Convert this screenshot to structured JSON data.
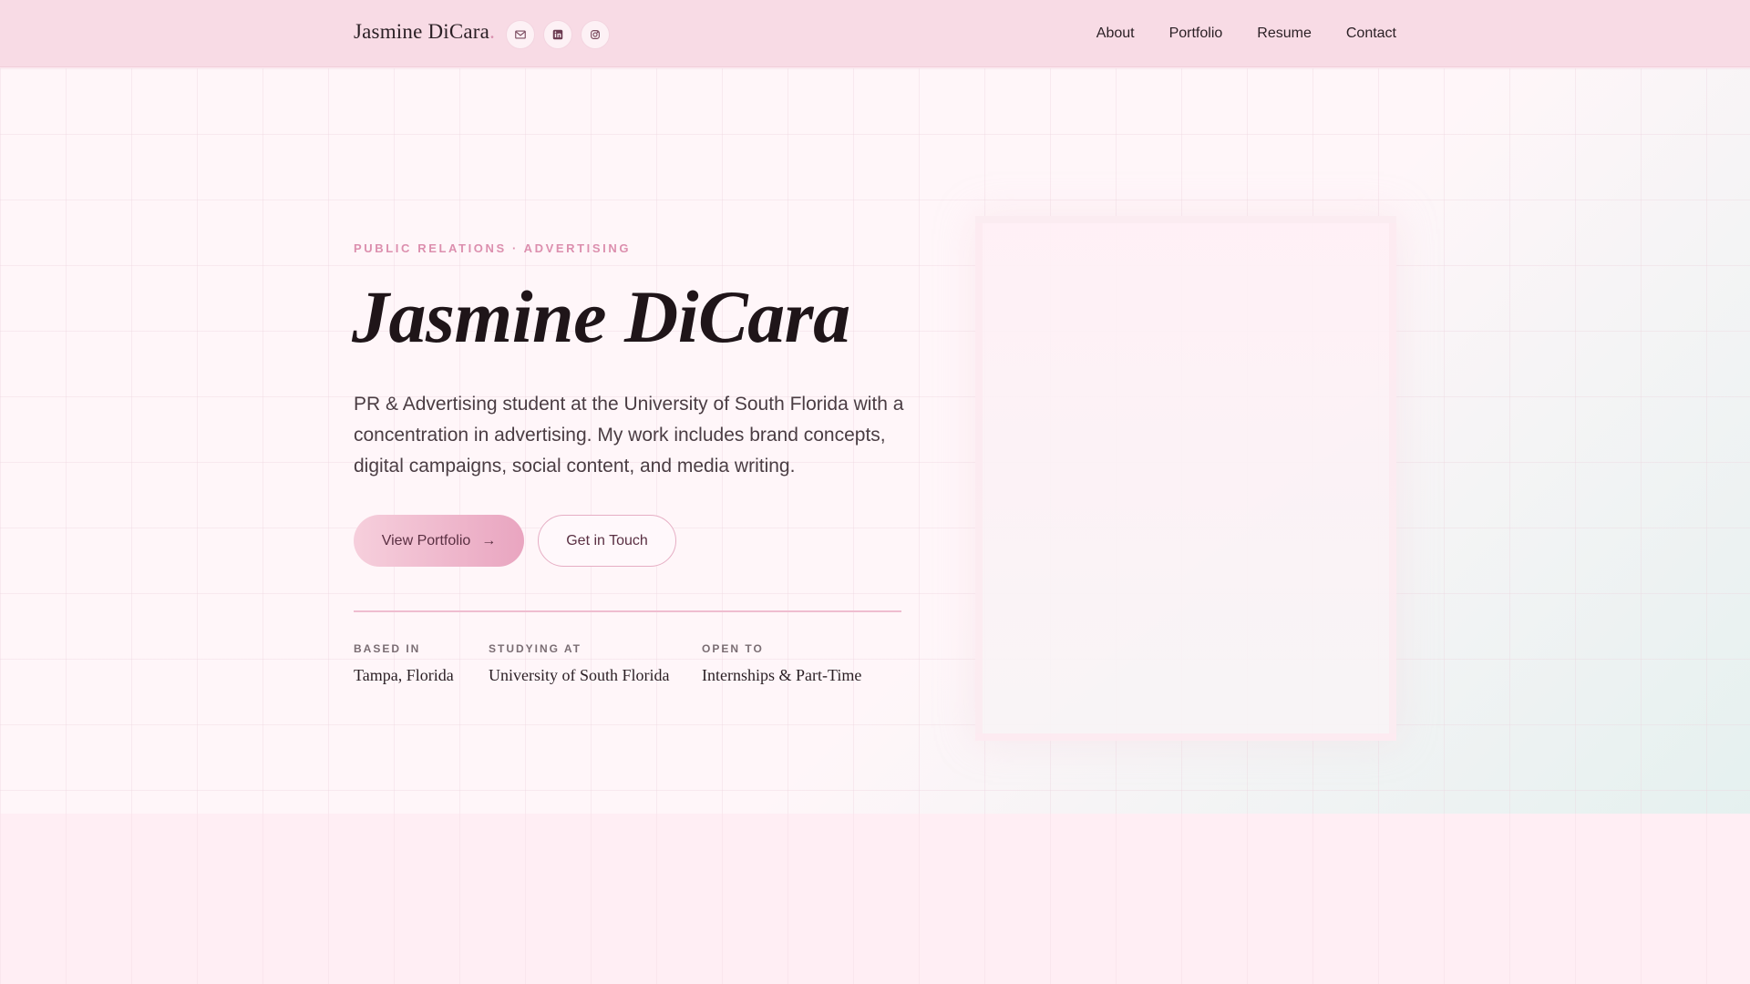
{
  "nav": {
    "brand": "Jasmine DiCara",
    "brand_dot": ".",
    "social": [
      {
        "icon": "mail-icon"
      },
      {
        "icon": "linkedin-icon"
      },
      {
        "icon": "instagram-icon"
      }
    ],
    "links": [
      "About",
      "Portfolio",
      "Resume",
      "Contact"
    ]
  },
  "hero": {
    "eyebrow": "PUBLIC RELATIONS · ADVERTISING",
    "title": "Jasmine DiCara",
    "intro": "PR & Advertising student at the University of South Florida with a concentration in advertising. My work includes brand concepts, digital campaigns, social content, and media writing.",
    "primary_button": "View Portfolio",
    "primary_arrow": "→",
    "secondary_button": "Get in Touch",
    "facts": [
      {
        "label": "BASED IN",
        "value": "Tampa, Florida"
      },
      {
        "label": "STUDYING AT",
        "value": "University of South Florida"
      },
      {
        "label": "OPEN TO",
        "value": "Internships & Part-Time"
      }
    ]
  },
  "colors": {
    "accent": "#e9a5c0",
    "nav_bg": "#f8dbe5",
    "eyebrow": "#dc8fae"
  }
}
